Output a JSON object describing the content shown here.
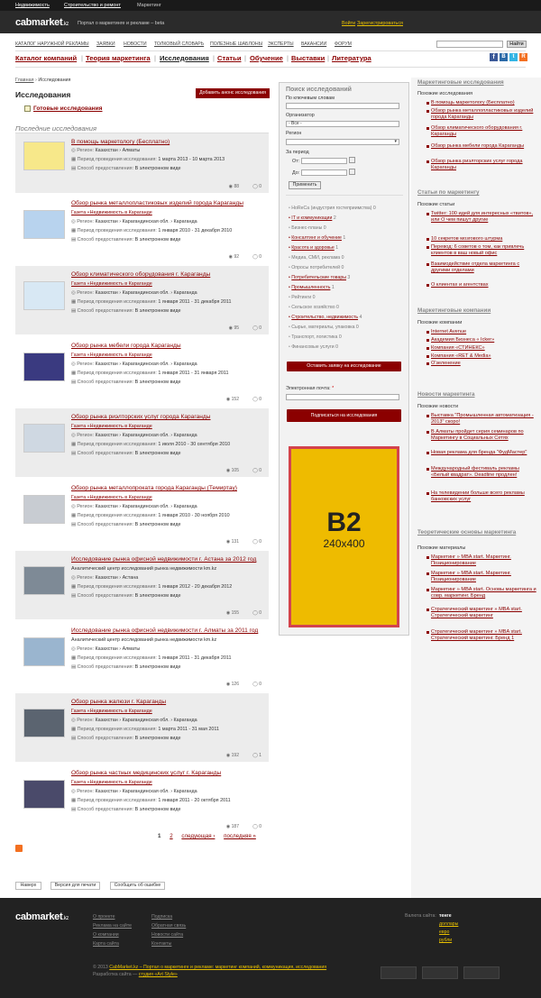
{
  "topbar": {
    "links": [
      "Недвижимость",
      "Строительство и ремонт",
      "Маркетинг"
    ]
  },
  "header": {
    "logo_main": "cabmarket",
    "logo_tld": ".kz",
    "tagline": "Портал о маркетинге и рекламе – beta",
    "login": "Войти",
    "register": "Зарегистрироваться"
  },
  "mainnav": {
    "items": [
      "КАТАЛОГ НАРУЖНОЙ РЕКЛАМЫ",
      "ЗАЯВКИ",
      "НОВОСТИ",
      "ТОЛКОВЫЙ СЛОВАРЬ",
      "ПОЛЕЗНЫЕ ШАБЛОНЫ",
      "ЭКСПЕРТЫ",
      "ВАКАНСИИ",
      "ФОРУМ"
    ],
    "search_btn": "Найти"
  },
  "subnav": {
    "items": [
      "Каталог компаний",
      "Теория маркетинга",
      "Исследования",
      "Статьи",
      "Обучение",
      "Выставки",
      "Литература"
    ]
  },
  "breadcrumb": {
    "home": "Главная",
    "current": "Исследования"
  },
  "page": {
    "title": "Исследования",
    "add_btn": "Добавить анонс исследования",
    "ready_link": "Готовые исследования",
    "recent": "Последние исследования"
  },
  "labels": {
    "region": "Регион:",
    "period": "Период проведения исследования:",
    "method": "Способ предоставления:"
  },
  "items": [
    {
      "title": "В помощь маркетологу (Бесплатно)",
      "sub": "",
      "region": "Казахстан › Алматы",
      "period": "1 марта 2013 - 10 марта 2013",
      "method": "В электронном виде",
      "views": "88",
      "comments": "0"
    },
    {
      "title": "Обзор рынка металлопластиковых изделий города Караганды",
      "sub": "Газета «Недвижимость в Караганде",
      "region": "Казахстан › Карагандинская обл. › Караганда",
      "period": "1 января 2010 - 31 декабря 2010",
      "method": "В электронном виде",
      "views": "92",
      "comments": "0"
    },
    {
      "title": "Обзор климатического оборудования г. Караганды",
      "sub": "Газета «Недвижимость в Караганде",
      "region": "Казахстан › Карагандинская обл. › Караганда",
      "period": "1 января 2011 - 31 декабря 2011",
      "method": "В электронном виде",
      "views": "95",
      "comments": "0"
    },
    {
      "title": "Обзор рынка мебели города Караганды",
      "sub": "Газета «Недвижимость в Караганде",
      "region": "Казахстан › Карагандинская обл. › Караганда",
      "period": "1 января 2011 - 31 января 2011",
      "method": "В электронном виде",
      "views": "152",
      "comments": "0"
    },
    {
      "title": "Обзор рынка риэлторских услуг города Караганды",
      "sub": "Газета «Недвижимость в Караганде",
      "region": "Казахстан › Карагандинская обл. › Караганда",
      "period": "1 июля 2010 - 30 сентября 2010",
      "method": "В электронном виде",
      "views": "105",
      "comments": "0"
    },
    {
      "title": "Обзор рынка металлопроката города Караганды (Темиртау)",
      "sub": "Газета «Недвижимость в Караганде",
      "region": "Казахстан › Карагандинская обл. › Караганда",
      "period": "1 января 2010 - 30 ноября 2010",
      "method": "В электронном виде",
      "views": "131",
      "comments": "0"
    },
    {
      "title": "Исследование рынка офисной недвижимости г. Астана за 2012 год",
      "sub": "Аналитический центр исследований рынка недвижимости km.kz",
      "region": "Казахстан › Астана",
      "period": "1 января 2012 - 20 декабря 2012",
      "method": "В электронном виде",
      "views": "155",
      "comments": "0"
    },
    {
      "title": "Исследование рынка офисной недвижимости г. Алматы за 2011 год",
      "sub": "Аналитический центр исследований рынка недвижимости km.kz",
      "region": "Казахстан › Алматы",
      "period": "1 января 2011 - 31 декабря 2011",
      "method": "В электронном виде",
      "views": "126",
      "comments": "0"
    },
    {
      "title": "Обзор рынка жалюзи г. Караганды",
      "sub": "Газета «Недвижимость в Караганде",
      "region": "Казахстан › Карагандинская обл. › Караганда",
      "period": "1 марта 2011 - 31 мая 2011",
      "method": "В электронном виде",
      "views": "192",
      "comments": "1"
    },
    {
      "title": "Обзор рынка частных медицинских услуг г. Караганды",
      "sub": "Газета «Недвижимость в Караганде",
      "region": "Казахстан › Карагандинская обл. › Караганда",
      "period": "1 января 2011 - 20 октября 2011",
      "method": "В электронном виде",
      "views": "187",
      "comments": "0"
    }
  ],
  "pagination": {
    "p1": "1",
    "p2": "2",
    "next": "следующая ›",
    "last": "последняя »"
  },
  "search": {
    "title": "Поиск исследований",
    "keywords": "По ключевым словам",
    "org": "Организатор",
    "org_value": "- Все -",
    "region": "Регион",
    "period": "За период",
    "from": "От:",
    "to": "До:",
    "apply": "Применить"
  },
  "categories": [
    {
      "name": "HoReCa (индустрия гостеприимства)",
      "count": "0",
      "link": false
    },
    {
      "name": "IT и коммуникации",
      "count": "2",
      "link": true
    },
    {
      "name": "Бизнес-планы",
      "count": "0",
      "link": false
    },
    {
      "name": "Консалтинг и обучение",
      "count": "1",
      "link": true
    },
    {
      "name": "Красота и здоровье",
      "count": "1",
      "link": true
    },
    {
      "name": "Медиа, СМИ, реклама",
      "count": "0",
      "link": false
    },
    {
      "name": "Опросы потребителей",
      "count": "0",
      "link": false
    },
    {
      "name": "Потребительские товары",
      "count": "3",
      "link": true
    },
    {
      "name": "Промышленность",
      "count": "1",
      "link": true
    },
    {
      "name": "Рейтинги",
      "count": "0",
      "link": false
    },
    {
      "name": "Сельское хозяйство",
      "count": "0",
      "link": false
    },
    {
      "name": "Строительство, недвижимость",
      "count": "4",
      "link": true
    },
    {
      "name": "Сырье, материалы, упаковка",
      "count": "0",
      "link": false
    },
    {
      "name": "Транспорт, логистика",
      "count": "0",
      "link": false
    },
    {
      "name": "Финансовые услуги",
      "count": "0",
      "link": false
    }
  ],
  "order_btn": "Оставить заявку на исследование",
  "email": {
    "label": "Электронная почта:",
    "required": "*",
    "subscribe": "Подписаться на исследования"
  },
  "banner": {
    "big": "B2",
    "size": "240x400"
  },
  "right": {
    "s1": {
      "head": "Маркетинговые исследования",
      "label": "Похожие исследования",
      "links": [
        "В помощь маркетологу (Бесплатно)",
        "Обзор рынка металлопластиковых изделий города Караганды",
        "Обзор климатического оборудования г. Караганды",
        "Обзор рынка мебели города Караганды",
        "Обзор рынка риэлторских услуг города Караганды"
      ]
    },
    "s2": {
      "head": "Статьи по маркетингу",
      "label": "Похожие статьи",
      "links": [
        "Twitter: 100 идей для интересных «твитов», или О чем пишут другие",
        "10 секретов мозгового штурма",
        "Перевод: 6 советов о том, как привлечь клиентов в ваш новый офис",
        "Взаимодействие отдела маркетинга с другими отделами",
        "О клиентах и агентствах"
      ]
    },
    "s3": {
      "head": "Маркетинговые компании",
      "label": "Похожие компании",
      "links": [
        "Internet Avenue",
        "Академия Бизнеса « Icker»",
        "Компания «СТИНЕКС»",
        "Компания «RET & Media»",
        "О'зеленение"
      ]
    },
    "s4": {
      "head": "Новости маркетинга",
      "label": "Похожие новости",
      "links": [
        "Выставка \"Промышленная автоматизация - 2013\" скоро!",
        "В Алматы пройдет серия семинаров по Маркетингу в Социальных Сетях",
        "Новая реклама для бренда \"ФудМастер\"",
        "Международный фестиваль рекламы «Белый квадрат». Deadline продлен!",
        "На телевидении больше всего рекламы банковских услуг"
      ]
    },
    "s5": {
      "head": "Теоретические основы маркетинга",
      "label": "Похожие материалы",
      "links": [
        "Маркетинг » MBA start. Маркетинг. Позиционирование",
        "Маркетинг » MBA start. Маркетинг. Позиционирование",
        "Маркетинг » MBA start. Основы маркетинга и совр. маркетинг. Бренд",
        "Стратегический маркетинг » MBA start. Стратегический маркетинг",
        "Стратегический маркетинг » MBA start. Стратегический маркетинг. Бренд 1"
      ]
    }
  },
  "bottom_btns": [
    "Наверх",
    "Версия для печати",
    "Сообщить об ошибке"
  ],
  "footer": {
    "col1": [
      "О проекте",
      "Реклама на сайте",
      "О компании",
      "Карта сайта"
    ],
    "col2": [
      "Подписка",
      "Обратная связь",
      "Новости сайта",
      "Контакты"
    ],
    "currency_label": "Валюта сайта:",
    "currencies": [
      "тенге",
      "доллары",
      "евро",
      "рубли"
    ],
    "copy_prefix": "© 2013",
    "copy_link": "CabMarket.kz – Портал о маркетинге и рекламе: маркетинг компаний, коммуникация, исследования",
    "dev_prefix": "Разработка сайта —",
    "dev_link": "студия «Art Style»"
  }
}
